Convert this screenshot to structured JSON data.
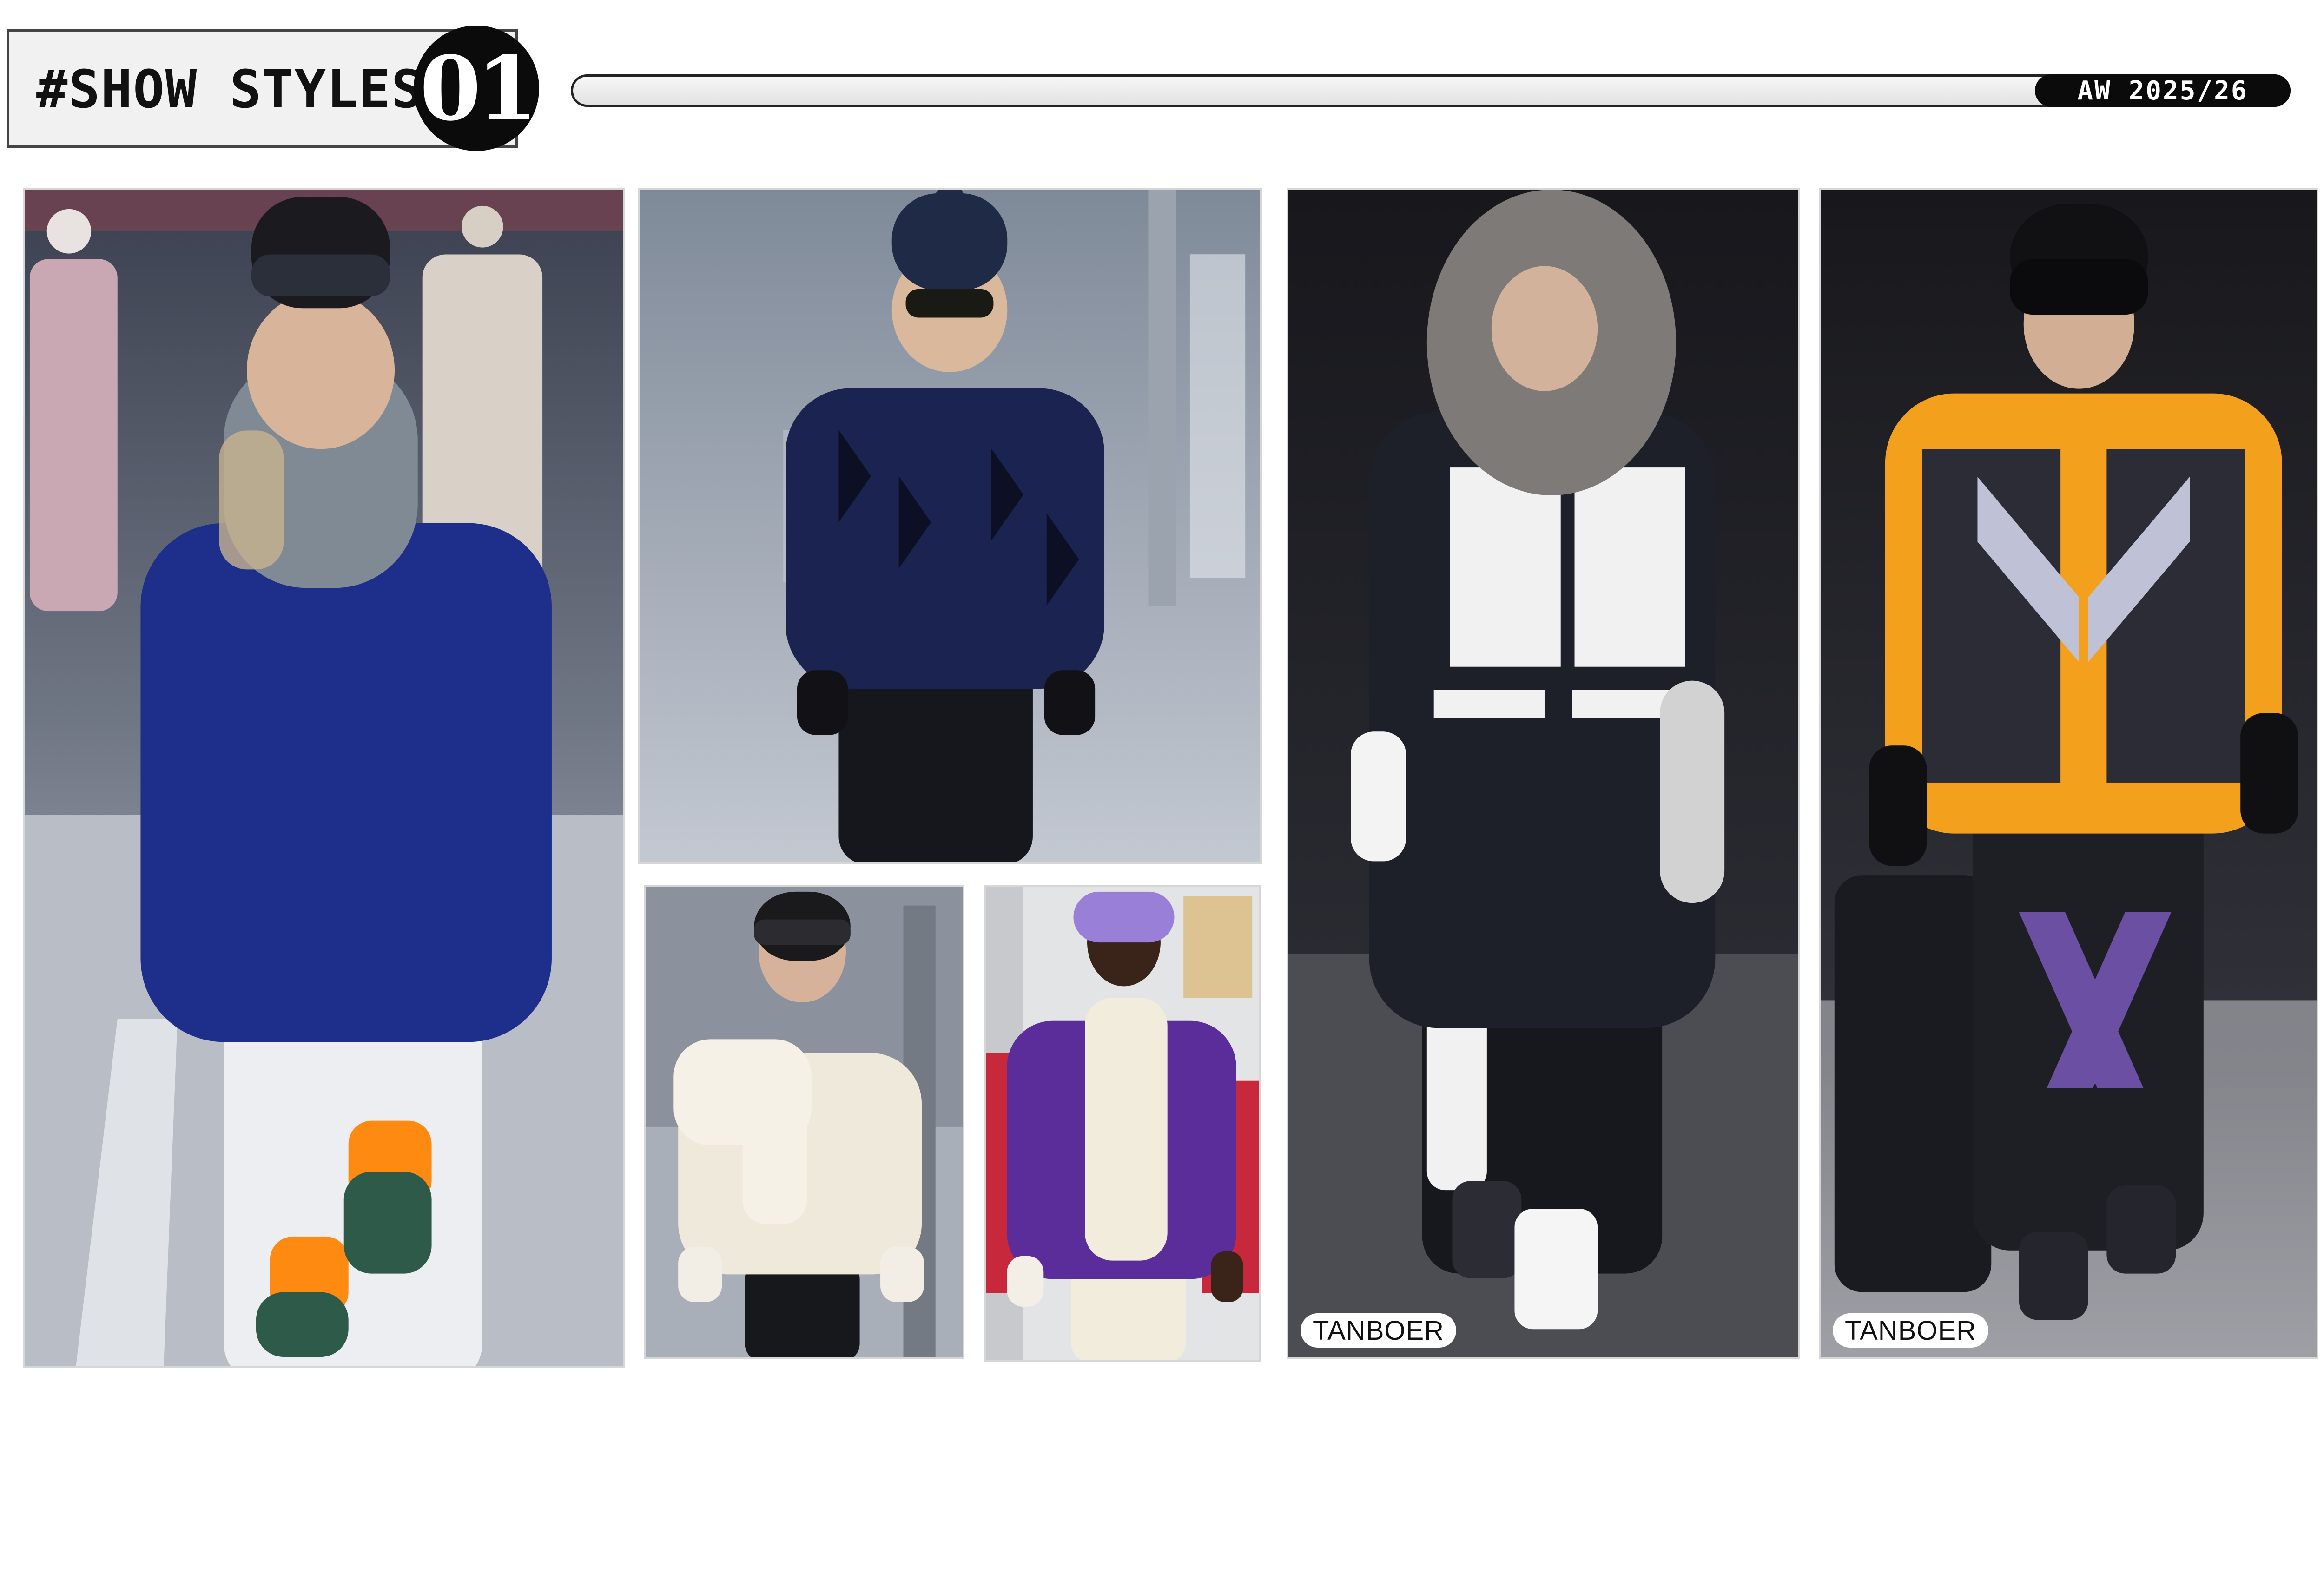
{
  "header": {
    "title": "#SHOW STYLES",
    "number": "01",
    "season": "AW 2025/26"
  },
  "photos": [
    {
      "id": "photo-1",
      "subject": "model in navy down parka with fur-trim hood, white pants, orange socks",
      "brand_label": ""
    },
    {
      "id": "photo-2",
      "subject": "model in navy diamond-quilted hooded puffer, beanie, sunglasses",
      "brand_label": ""
    },
    {
      "id": "photo-3",
      "subject": "model in cream cable-knit sweater with puffer scarf and helmet",
      "brand_label": ""
    },
    {
      "id": "photo-4",
      "subject": "model in purple puffer jacket over cream hoodie with purple goggles",
      "brand_label": ""
    },
    {
      "id": "photo-5",
      "subject": "model in black and white ski suit with fur-trim hood",
      "brand_label": "TANBOER"
    },
    {
      "id": "photo-6",
      "subject": "model in orange and black ski jacket with helmet and goggles",
      "brand_label": "TANBOER"
    }
  ],
  "colors": {
    "header_dark": "#0b0b0b",
    "header_box_bg": "#f1f1f1",
    "navy": "#1d2f8a",
    "purple": "#5a2d9a",
    "orange": "#f3a11c",
    "cream": "#f1ecdc"
  }
}
